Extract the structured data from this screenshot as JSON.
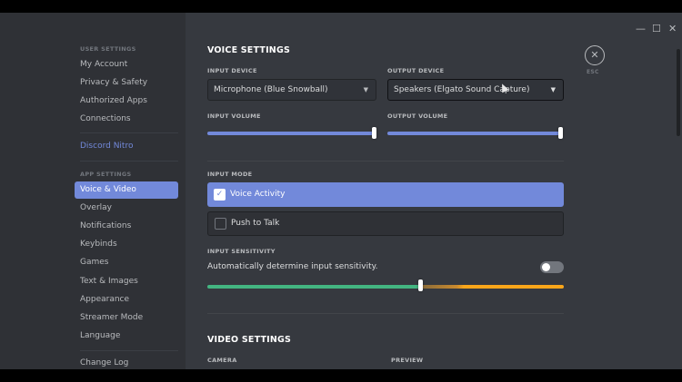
{
  "window": {
    "minimize_icon": "minimize-icon",
    "maximize_icon": "maximize-icon",
    "close_icon": "close-icon"
  },
  "sidebar": {
    "user_settings_label": "USER SETTINGS",
    "user_items": [
      "My Account",
      "Privacy & Safety",
      "Authorized Apps",
      "Connections"
    ],
    "nitro_label": "Discord Nitro",
    "app_settings_label": "APP SETTINGS",
    "app_items": [
      "Voice & Video",
      "Overlay",
      "Notifications",
      "Keybinds",
      "Games",
      "Text & Images",
      "Appearance",
      "Streamer Mode",
      "Language"
    ],
    "active_item": "Voice & Video",
    "changelog_label": "Change Log"
  },
  "esc": {
    "label": "ESC"
  },
  "voice": {
    "title": "VOICE SETTINGS",
    "input_device_label": "INPUT DEVICE",
    "input_device_value": "Microphone (Blue Snowball)",
    "output_device_label": "OUTPUT DEVICE",
    "output_device_value": "Speakers (Elgato Sound Capture)",
    "input_volume_label": "INPUT VOLUME",
    "input_volume_level": 1.0,
    "output_volume_label": "OUTPUT VOLUME",
    "output_volume_level": 1.0,
    "input_mode_label": "INPUT MODE",
    "mode_voice_activity": "Voice Activity",
    "mode_push_to_talk": "Push to Talk",
    "selected_mode": "Voice Activity",
    "sensitivity_label": "INPUT SENSITIVITY",
    "auto_sensitivity_text": "Automatically determine input sensitivity.",
    "auto_sensitivity_enabled": false,
    "sensitivity_level": 0.6
  },
  "video": {
    "title": "VIDEO SETTINGS",
    "camera_label": "CAMERA",
    "preview_label": "PREVIEW"
  },
  "colors": {
    "accent": "#7289da",
    "background": "#36393f",
    "sidebar": "#2f3136",
    "green": "#43b581",
    "yellow": "#faa61a"
  }
}
